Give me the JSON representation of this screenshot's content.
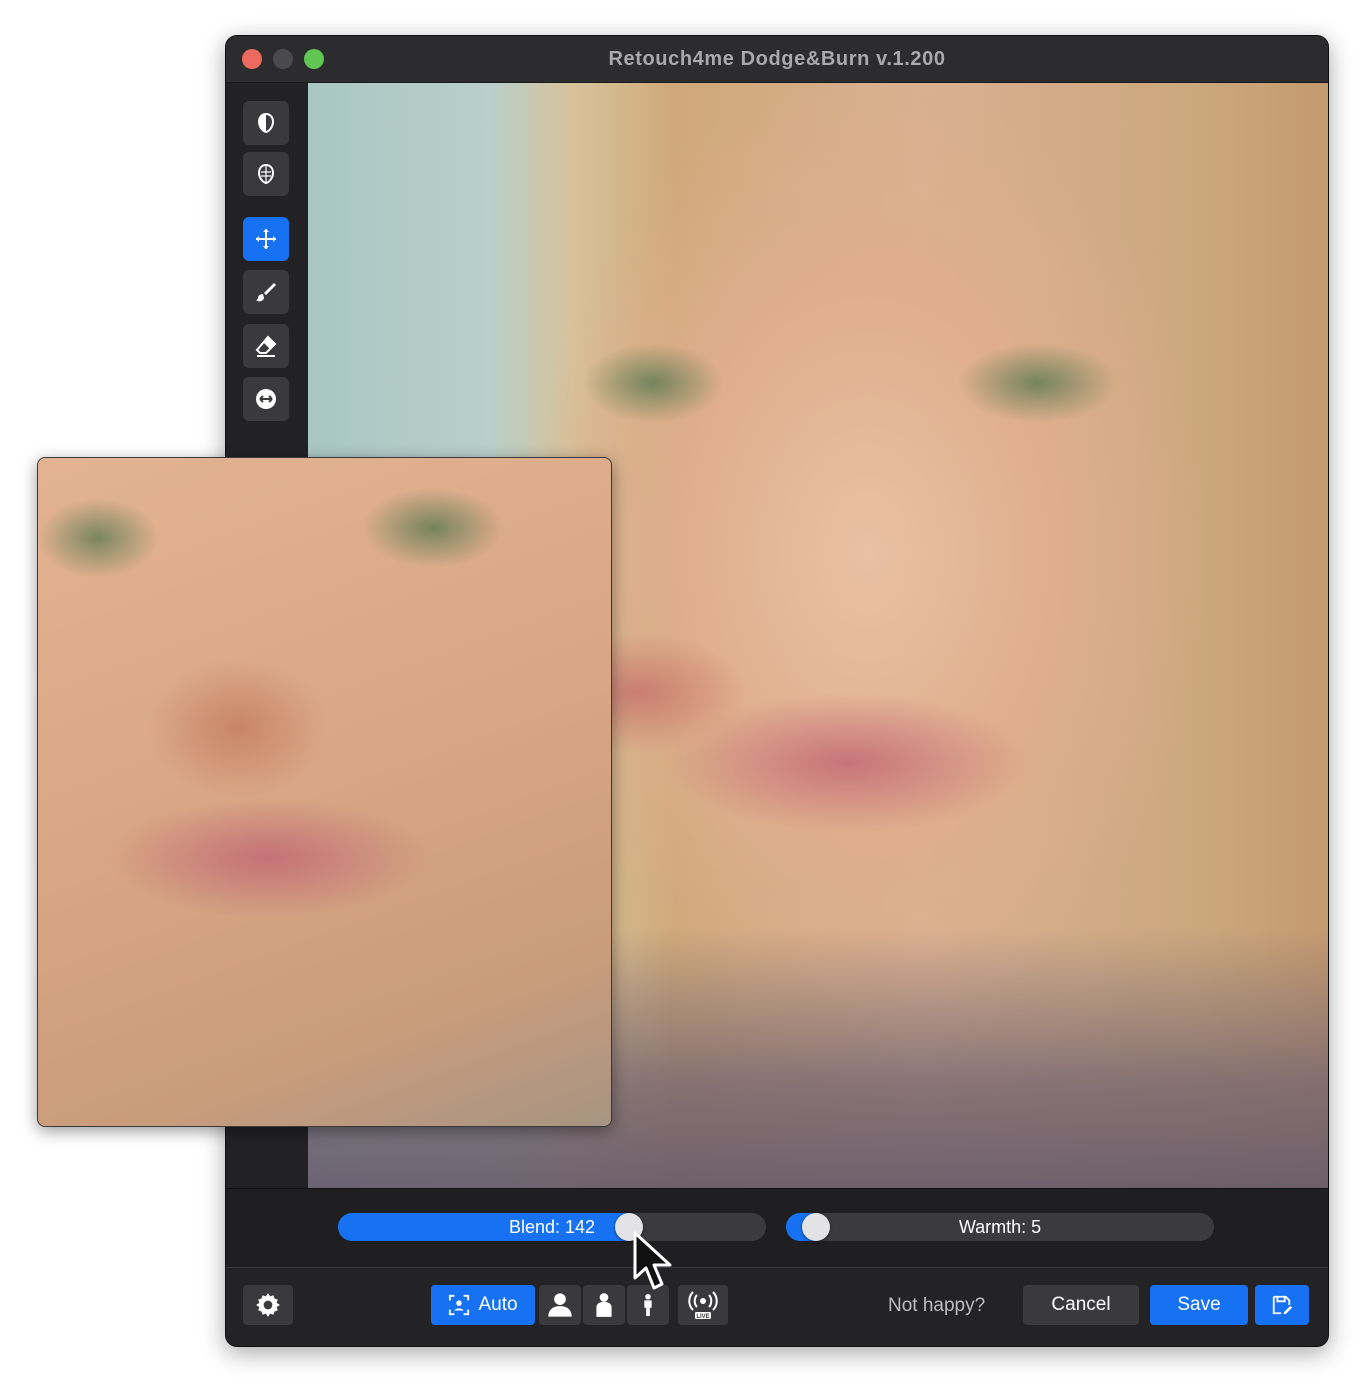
{
  "window": {
    "title": "Retouch4me Dodge&Burn v.1.200"
  },
  "toolbar": {
    "tools": [
      {
        "icon": "face-half-icon",
        "active": false
      },
      {
        "icon": "face-mask-icon",
        "active": false
      },
      {
        "icon": "move-icon",
        "active": true
      },
      {
        "icon": "brush-icon",
        "active": false
      },
      {
        "icon": "eraser-icon",
        "active": false
      },
      {
        "icon": "compare-icon",
        "active": false
      }
    ]
  },
  "sliders": {
    "blend": {
      "label": "Blend: 142",
      "fill_fraction": 0.68
    },
    "warmth": {
      "label": "Warmth: 5",
      "fill_fraction": 0.07
    }
  },
  "bottom": {
    "auto_label": "Auto",
    "not_happy_label": "Not happy?",
    "cancel_label": "Cancel",
    "save_label": "Save",
    "live_badge": "LIVE"
  },
  "colors": {
    "accent": "#1672f2",
    "window_bg": "#252527",
    "button_bg": "#3a3a3c"
  }
}
